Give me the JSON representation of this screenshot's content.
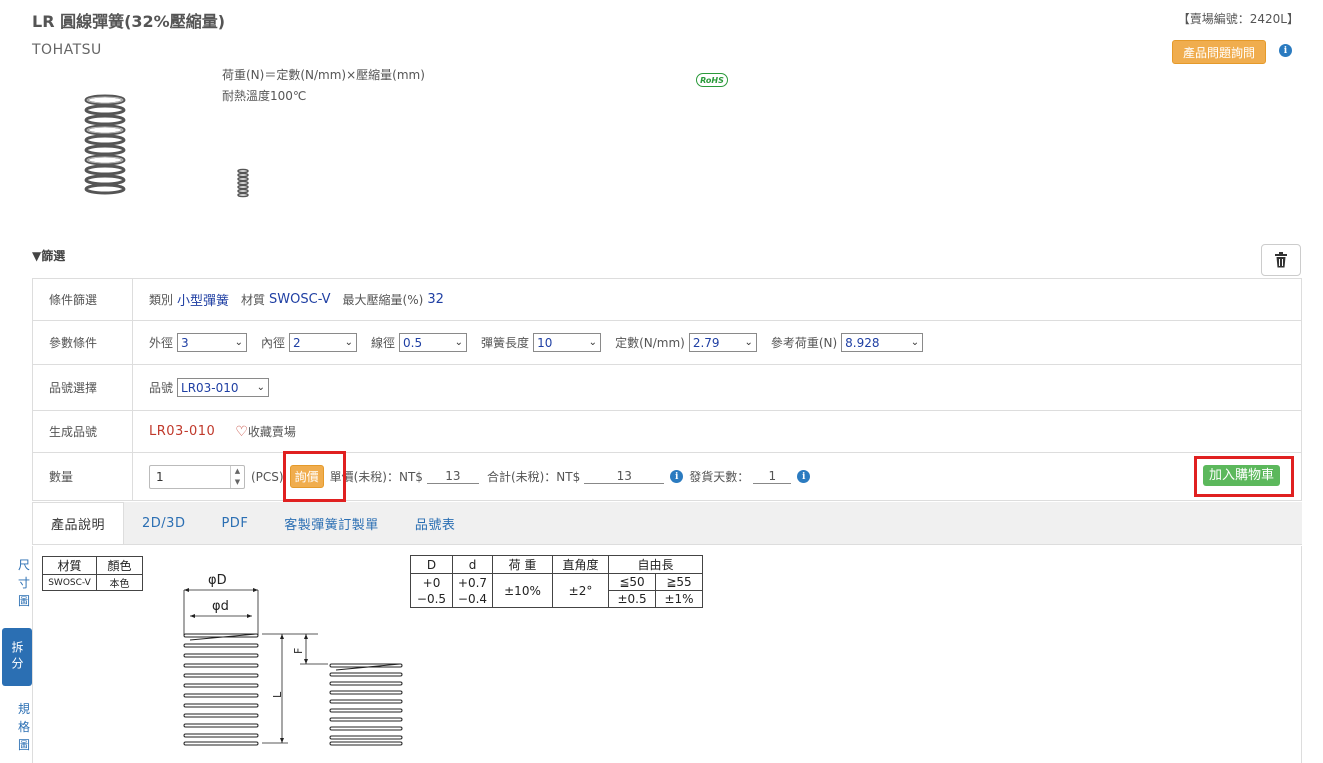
{
  "header": {
    "title": "LR 圓線彈簧(32%壓縮量)",
    "store_code": "【賣場編號：2420L】",
    "brand": "TOHATSU",
    "inquiry_label": "產品問題詢問",
    "info_glyph": "i",
    "desc_line1": "荷重(N)＝定數(N/mm)×壓縮量(mm)",
    "desc_line2": "耐熱溫度100℃",
    "rohs": "RoHS"
  },
  "filter": {
    "toggle_label": "▼篩選",
    "rows": {
      "condition": {
        "label": "條件篩選",
        "category_label": "類別",
        "category_value": "小型彈簧",
        "material_label": "材質",
        "material_value": "SWOSC-V",
        "max_comp_label": "最大壓縮量(%)",
        "max_comp_value": "32"
      },
      "params": {
        "label": "參數條件",
        "od_label": "外徑",
        "od_value": "3",
        "id_label": "內徑",
        "id_value": "2",
        "wire_label": "線徑",
        "wire_value": "0.5",
        "len_label": "彈簧長度",
        "len_value": "10",
        "const_label": "定數(N/mm)",
        "const_value": "2.79",
        "load_label": "參考荷重(N)",
        "load_value": "8.928"
      },
      "part_select": {
        "label": "品號選擇",
        "part_label": "品號",
        "part_value": "LR03-010"
      },
      "generated": {
        "label": "生成品號",
        "part_no": "LR03-010",
        "favorite_label": "收藏賣場"
      },
      "quantity": {
        "label": "數量",
        "qty_value": "1",
        "unit": "(PCS)",
        "price_btn": "詢價",
        "unit_price_label": "單價(未稅)：NT$",
        "unit_price": "13",
        "total_label": "合計(未稅)：NT$",
        "total": "13",
        "ship_days_label": "發貨天數：",
        "ship_days": "1",
        "cart_btn": "加入購物車"
      }
    }
  },
  "tabs": [
    {
      "label": "產品說明"
    },
    {
      "label": "2D/3D"
    },
    {
      "label": "PDF"
    },
    {
      "label": "客製彈簧訂製單"
    },
    {
      "label": "品號表"
    }
  ],
  "side_nav": {
    "item1": "尺寸圖",
    "item2": "拆分",
    "item3": "規格圖"
  },
  "spec": {
    "mat_table": {
      "headers": [
        "材質",
        "顏色"
      ],
      "row": [
        "SWOSC-V",
        "本色"
      ]
    },
    "tol_table": {
      "h_D": "D",
      "h_d": "d",
      "h_load": "荷 重",
      "h_sq": "直角度",
      "h_free": "自由長",
      "D_tol": [
        "+0",
        "−0.5"
      ],
      "d_tol": [
        "+0.7",
        "−0.4"
      ],
      "load_tol": "±10%",
      "sq_tol": "±2°",
      "free_le": "≦50",
      "free_ge": "≧55",
      "free_le_tol": "±0.5",
      "free_ge_tol": "±1%"
    },
    "drawing": {
      "phiD": "φD",
      "phid": "φd",
      "F": "F",
      "L": "L"
    }
  },
  "colors": {
    "orange": "#f0ad4e",
    "green": "#5cb85c",
    "blue": "#2b6fb3",
    "red_highlight": "#e02020",
    "part_no_red": "#c0392b"
  }
}
